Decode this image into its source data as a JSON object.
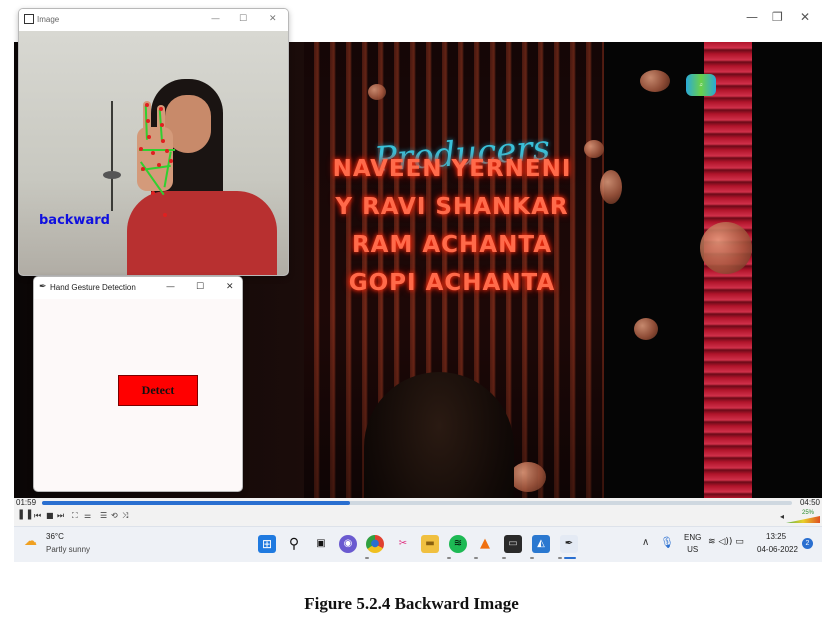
{
  "vlc": {
    "window_controls": {
      "minimize": "—",
      "restore": "❐",
      "close": "✕"
    },
    "video_credits": {
      "script_text": "Producers",
      "lines": [
        "NAVEEN YERNENI",
        "Y RAVI SHANKAR",
        "RAM ACHANTA",
        "GOPI ACHANTA"
      ]
    },
    "playback": {
      "elapsed": "01:59",
      "total": "04:50",
      "progress_fraction": 0.41,
      "volume_label": "25%"
    }
  },
  "image_window": {
    "title": "Image",
    "window_controls": {
      "minimize": "—",
      "maximize": "☐",
      "close": "✕"
    },
    "gesture_text": "backward"
  },
  "hgd_window": {
    "title": "Hand Gesture Detection",
    "window_controls": {
      "minimize": "—",
      "maximize": "☐",
      "close": "✕"
    },
    "detect_label": "Detect",
    "detect_color": "#ff0000"
  },
  "taskbar": {
    "weather": {
      "temp": "36°C",
      "desc": "Partly sunny"
    },
    "tray": {
      "lang_line1": "ENG",
      "lang_line2": "US",
      "time": "13:25",
      "date": "04-06-2022",
      "notifications": "2"
    },
    "icons": [
      "windows-start-icon",
      "search-icon",
      "task-view-icon",
      "chat-icon",
      "chrome-icon",
      "snipping-tool-icon",
      "file-explorer-icon",
      "spotify-icon",
      "vlc-icon",
      "terminal-icon",
      "photos-icon",
      "python-feather-icon"
    ]
  },
  "caption": "Figure 5.2.4 Backward Image"
}
